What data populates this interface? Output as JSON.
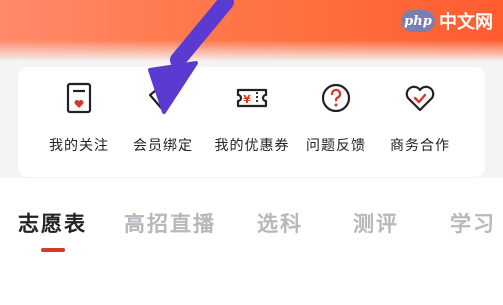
{
  "watermark": {
    "logo": "php",
    "text": "中文网"
  },
  "menu": {
    "items": [
      {
        "label": "我的关注",
        "icon": "follow-card-icon"
      },
      {
        "label": "会员绑定",
        "icon": "member-bind-icon"
      },
      {
        "label": "我的优惠券",
        "icon": "coupon-icon"
      },
      {
        "label": "问题反馈",
        "icon": "question-icon"
      },
      {
        "label": "商务合作",
        "icon": "handshake-heart-icon"
      }
    ]
  },
  "tabs": {
    "active_index": 0,
    "items": [
      "志愿表",
      "高招直播",
      "选科",
      "测评",
      "学习"
    ]
  },
  "colors": {
    "banner": "#ff6b3a",
    "accent": "#d9362c",
    "arrow": "#5b3ad1",
    "text": "#222222",
    "tab_inactive": "#b8b8bc"
  }
}
